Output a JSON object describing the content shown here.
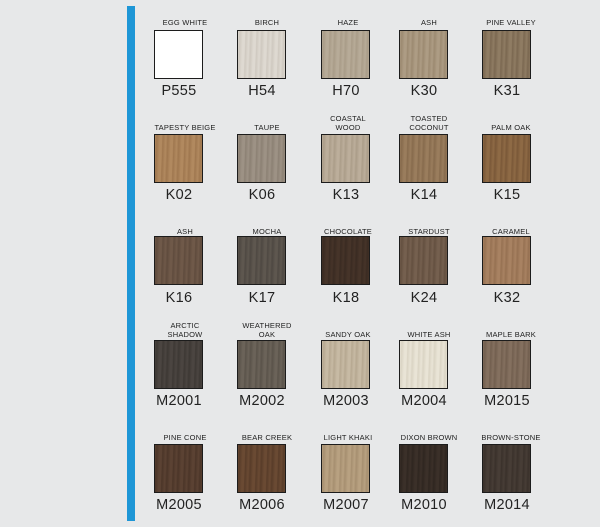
{
  "accent_color": "#1e96d6",
  "rows": [
    [
      {
        "name": "EGG WHITE",
        "code": "P555",
        "color": "#ffffff",
        "grain": "#ffffff"
      },
      {
        "name": "BIRCH",
        "code": "H54",
        "color": "#ded9d1",
        "grain": "#cfc9c0"
      },
      {
        "name": "HAZE",
        "code": "H70",
        "color": "#b7ab98",
        "grain": "#a99c88"
      },
      {
        "name": "ASH",
        "code": "K30",
        "color": "#ad9c84",
        "grain": "#9c8a71"
      },
      {
        "name": "PINE VALLEY",
        "code": "K31",
        "color": "#8f7c63",
        "grain": "#7b6851"
      }
    ],
    [
      {
        "name": "TAPESTY BEIGE",
        "code": "K02",
        "color": "#b1895f",
        "grain": "#9f774f"
      },
      {
        "name": "TAUPE",
        "code": "K06",
        "color": "#9d9285",
        "grain": "#8c8174"
      },
      {
        "name": "COASTAL WOOD",
        "code": "K13",
        "color": "#bcae9b",
        "grain": "#ab9d89"
      },
      {
        "name": "TOASTED COCONUT",
        "code": "K14",
        "color": "#9a7d5d",
        "grain": "#876b4d"
      },
      {
        "name": "PALM OAK",
        "code": "K15",
        "color": "#8e6a45",
        "grain": "#7a5838"
      }
    ],
    [
      {
        "name": "ASH",
        "code": "K16",
        "color": "#6f5949",
        "grain": "#5f4b3d"
      },
      {
        "name": "MOCHA",
        "code": "K17",
        "color": "#5e574f",
        "grain": "#4e4842"
      },
      {
        "name": "CHOCOLATE",
        "code": "K18",
        "color": "#463429",
        "grain": "#3a2b22"
      },
      {
        "name": "STARDUST",
        "code": "K24",
        "color": "#75604f",
        "grain": "#645040"
      },
      {
        "name": "CARAMEL",
        "code": "K32",
        "color": "#a88262",
        "grain": "#967152"
      }
    ],
    [
      {
        "name": "ARCTIC SHADOW",
        "code": "M2001",
        "color": "#4b4541",
        "grain": "#3d3834"
      },
      {
        "name": "WEATHERED OAK",
        "code": "M2002",
        "color": "#6b6359",
        "grain": "#5a534a"
      },
      {
        "name": "SANDY OAK",
        "code": "M2003",
        "color": "#c7baa4",
        "grain": "#b6a891"
      },
      {
        "name": "WHITE ASH",
        "code": "M2004",
        "color": "#e9e4d6",
        "grain": "#dad4c4"
      },
      {
        "name": "MAPLE BARK",
        "code": "M2015",
        "color": "#84705f",
        "grain": "#725f4f"
      }
    ],
    [
      {
        "name": "PINE CONE",
        "code": "M2005",
        "color": "#5b4233",
        "grain": "#4b3528"
      },
      {
        "name": "BEAR  CREEK",
        "code": "M2006",
        "color": "#6a4a33",
        "grain": "#583c29"
      },
      {
        "name": "LIGHT KHAKI",
        "code": "M2007",
        "color": "#b8a181",
        "grain": "#a68f70"
      },
      {
        "name": "DIXON BROWN",
        "code": "M2010",
        "color": "#3b3029",
        "grain": "#2f2620"
      },
      {
        "name": "BROWN-STONE",
        "code": "M2014",
        "color": "#473d36",
        "grain": "#3a312b"
      }
    ]
  ]
}
